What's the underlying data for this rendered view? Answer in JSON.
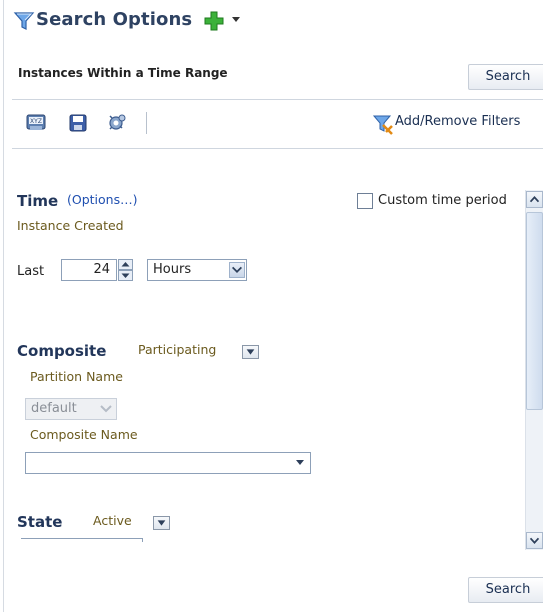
{
  "header": {
    "title": "Search Options",
    "title_icon": "funnel-icon",
    "add_icon": "green-plus-icon",
    "menu_icon": "dropdown-arrow-icon"
  },
  "section": {
    "title": "Instances Within a Time Range",
    "search_button": "Search",
    "bottom_search_button": "Search"
  },
  "toolbar": {
    "icons": [
      "xml-query-icon",
      "save-icon",
      "settings-icon"
    ],
    "add_remove_filters": "Add/Remove Filters"
  },
  "time": {
    "heading": "Time",
    "options_link": "(Options…)",
    "sub_label": "Instance Created",
    "custom_period_label": "Custom time period",
    "custom_period_checked": false,
    "last_label": "Last",
    "last_value": "24",
    "unit_value": "Hours"
  },
  "composite": {
    "heading": "Composite",
    "mode_value": "Participating",
    "partition_label": "Partition Name",
    "partition_value": "default",
    "composite_name_label": "Composite Name",
    "composite_name_value": ""
  },
  "state": {
    "heading": "State",
    "value": "Active"
  },
  "colors": {
    "accent_blue": "#1f4fb0",
    "heading_navy": "#22365a",
    "olive_label": "#6b5a1e"
  }
}
